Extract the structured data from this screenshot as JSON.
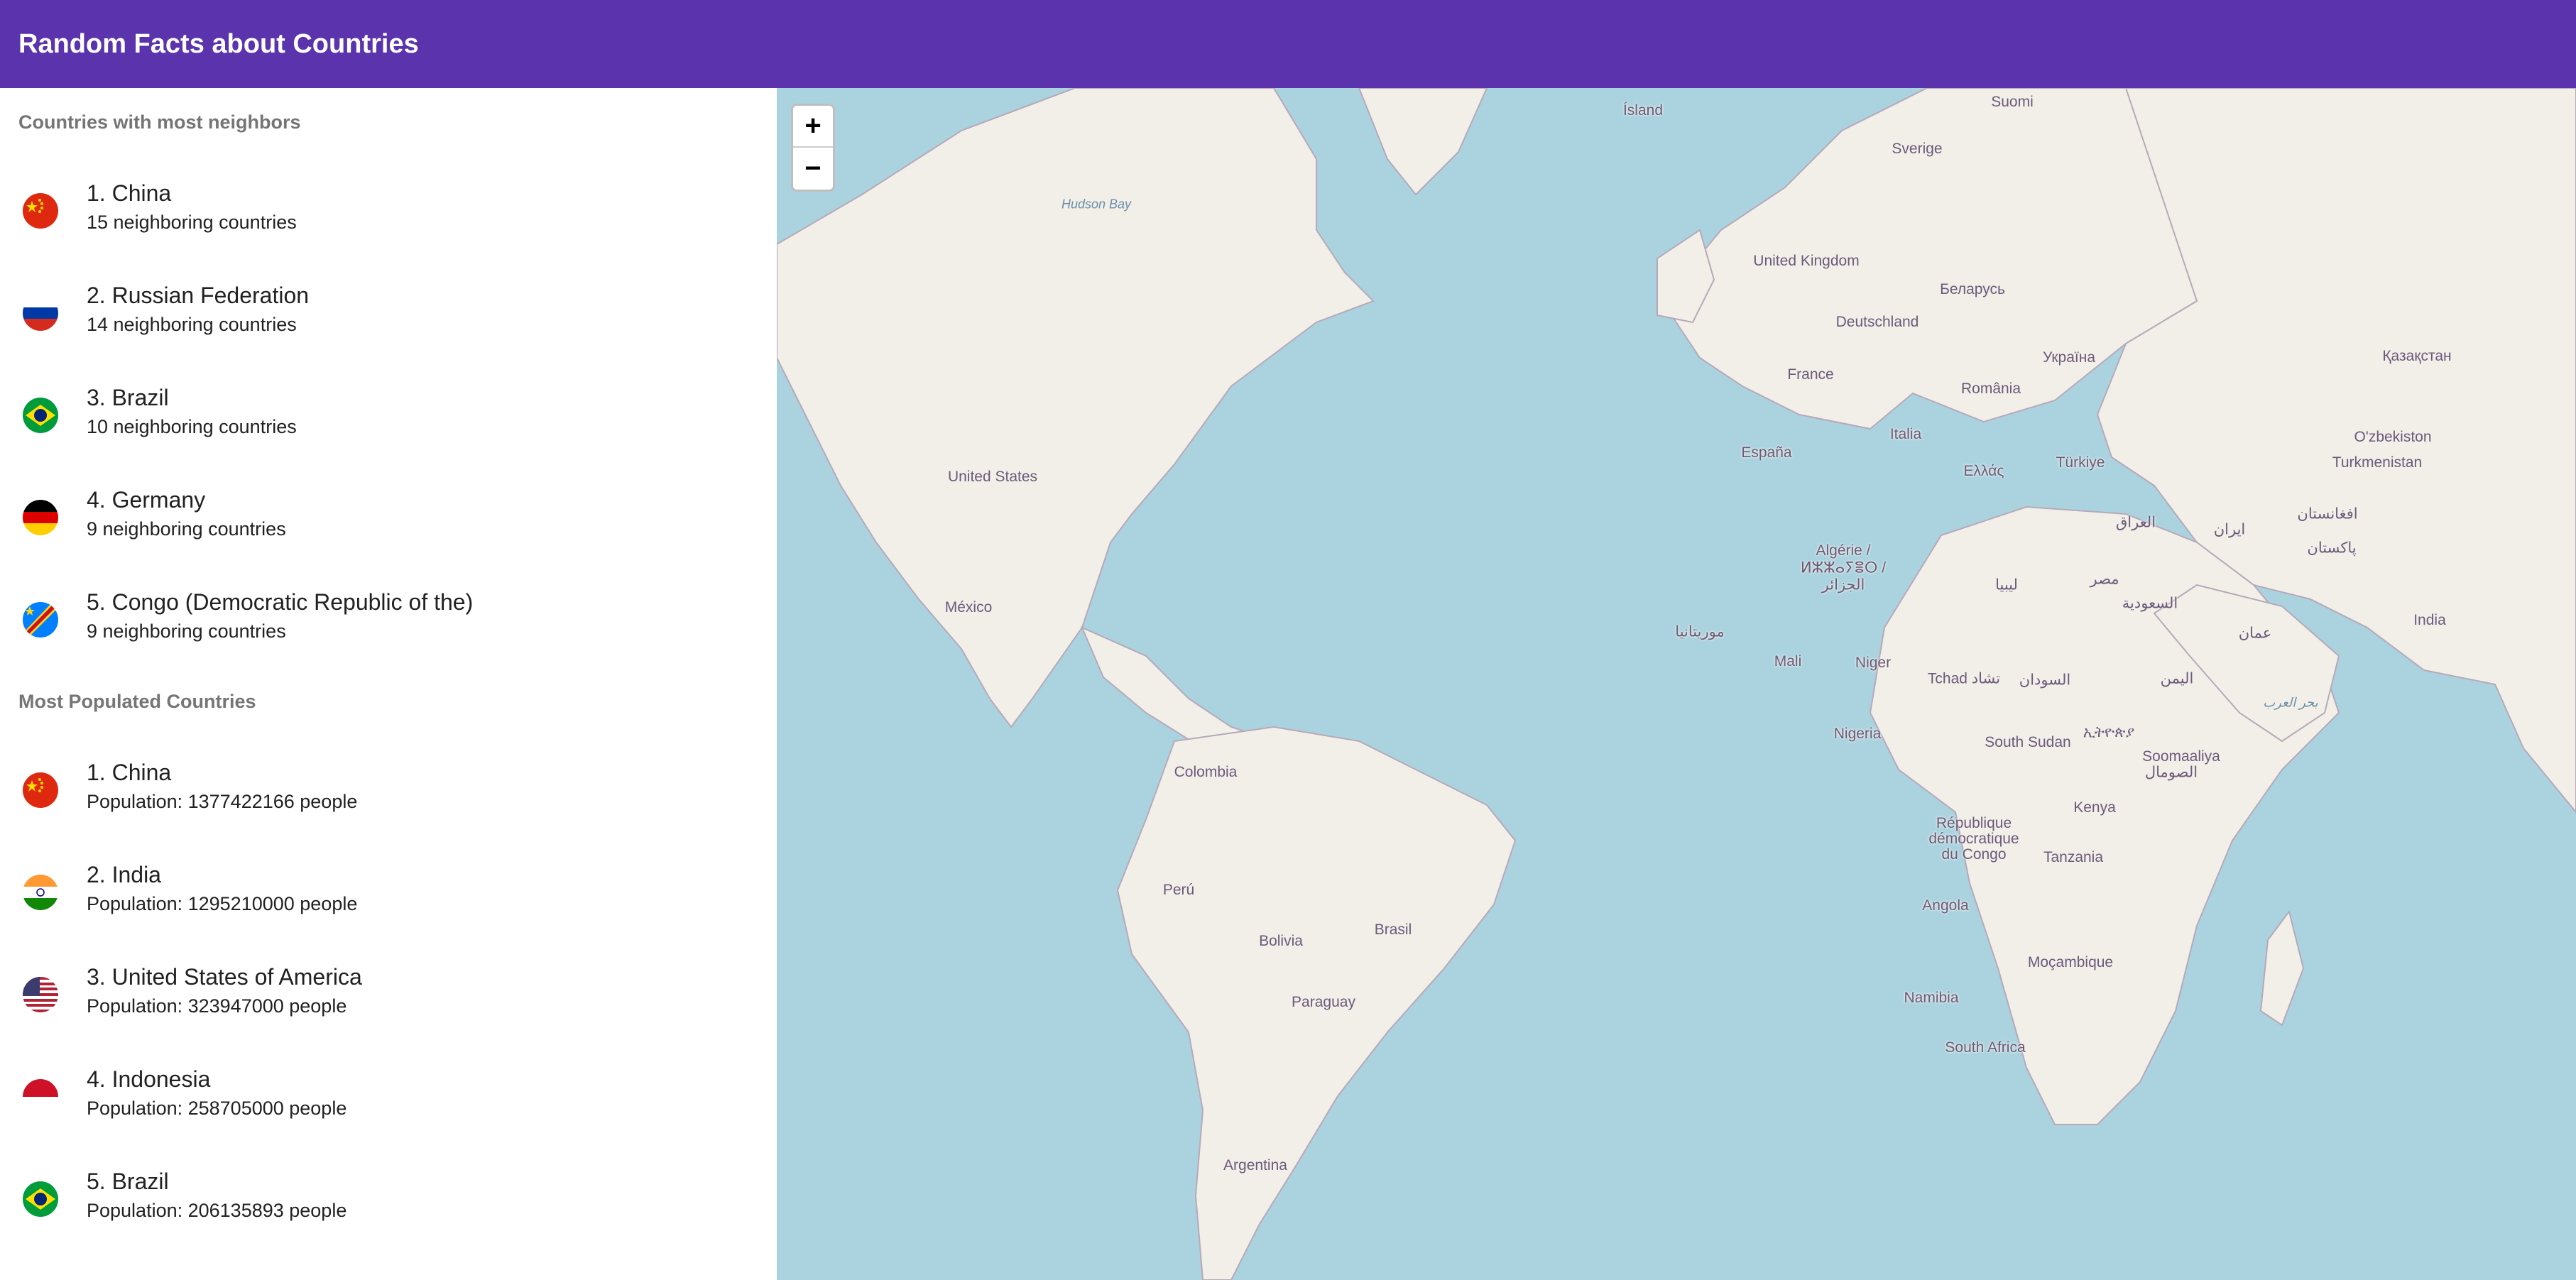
{
  "app": {
    "title": "Random Facts about Countries"
  },
  "neighbors": {
    "header": "Countries with most neighbors",
    "items": [
      {
        "title": "1. China",
        "subtitle": "15 neighboring countries",
        "flag": "china-flag"
      },
      {
        "title": "2. Russian Federation",
        "subtitle": "14 neighboring countries",
        "flag": "russia-flag"
      },
      {
        "title": "3. Brazil",
        "subtitle": "10 neighboring countries",
        "flag": "brazil-flag"
      },
      {
        "title": "4. Germany",
        "subtitle": "9 neighboring countries",
        "flag": "germany-flag"
      },
      {
        "title": "5. Congo (Democratic Republic of the)",
        "subtitle": "9 neighboring countries",
        "flag": "drc-flag"
      }
    ]
  },
  "population": {
    "header": "Most Populated Countries",
    "items": [
      {
        "title": "1. China",
        "subtitle": "Population: 1377422166 people",
        "flag": "china-flag"
      },
      {
        "title": "2. India",
        "subtitle": "Population: 1295210000 people",
        "flag": "india-flag"
      },
      {
        "title": "3. United States of America",
        "subtitle": "Population: 323947000 people",
        "flag": "usa-flag"
      },
      {
        "title": "4. Indonesia",
        "subtitle": "Population: 258705000 people",
        "flag": "indonesia-flag"
      },
      {
        "title": "5. Brazil",
        "subtitle": "Population: 206135893 people",
        "flag": "brazil-flag"
      }
    ]
  },
  "map": {
    "zoom_in": "+",
    "zoom_out": "−",
    "labels": {
      "island": "Ísland",
      "suomi": "Suomi",
      "sverige": "Sverige",
      "hudson": "Hudson Bay",
      "uk": "United Kingdom",
      "belarus": "Беларусь",
      "deutschland": "Deutschland",
      "ukraina": "Україна",
      "kazakhstan": "Қазақстан",
      "france": "France",
      "romania": "România",
      "italia": "Italia",
      "espana": "España",
      "turkiye": "Türkiye",
      "uzbekiston": "O'zbekiston",
      "turkmenistan": "Turkmenistan",
      "ellas": "Ελλάς",
      "us": "United States",
      "iraq": "العراق",
      "iran": "ایران",
      "afghanistan": "افغانستان",
      "pakistan": "پاکستان",
      "algerie": "Algérie /",
      "algerie2": "ⵍⵣⵣⴰⵢⴻⵔ /",
      "algerie3": "الجزائر",
      "libya": "ليبيا",
      "misr": "مصر",
      "saudi": "السعودية",
      "oman": "عمان",
      "india": "India",
      "mexico": "México",
      "mauritania": "موريتانيا",
      "mali": "Mali",
      "niger": "Niger",
      "tchad": "Tchad تشاد",
      "sudan": "السودان",
      "yemen": "اليمن",
      "arabsea": "بحر العرب",
      "nigeria": "Nigeria",
      "ethiopia": "ኢትዮጵያ",
      "southsudan": "South Sudan",
      "somalia": "Soomaaliya",
      "somalia2": "الصومال",
      "colombia": "Colombia",
      "rdc": "République",
      "rdc2": "démocratique",
      "rdc3": "du Congo",
      "kenya": "Kenya",
      "peru": "Perú",
      "tanzania": "Tanzania",
      "brasil": "Brasil",
      "bolivia": "Bolivia",
      "angola": "Angola",
      "mozambique": "Moçambique",
      "paraguay": "Paraguay",
      "namibia": "Namibia",
      "southafrica": "South Africa",
      "argentina": "Argentina"
    }
  }
}
